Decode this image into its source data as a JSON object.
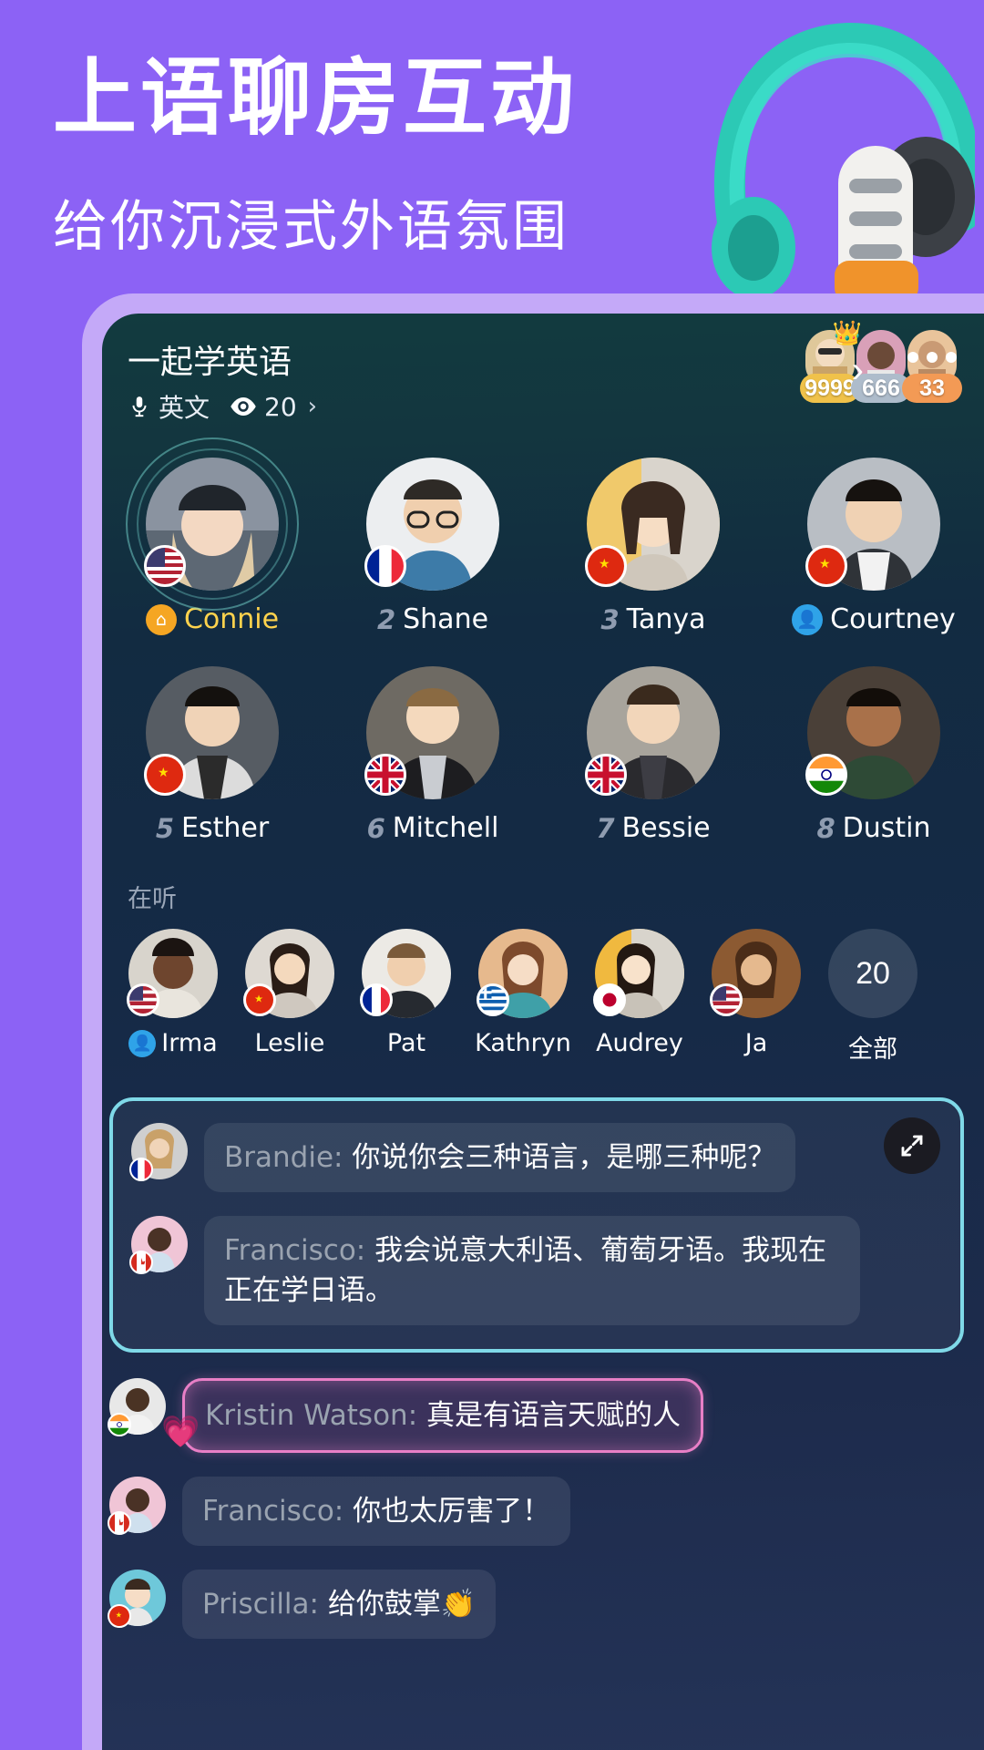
{
  "hero": {
    "title": "上语聊房互动",
    "subtitle": "给你沉浸式外语氛围",
    "illustration": "headphones-microphone-illustration"
  },
  "room": {
    "title": "一起学英语",
    "language_chip": {
      "icon": "microphone-icon",
      "label": "英文"
    },
    "viewers_chip": {
      "icon": "eye-icon",
      "label": "20",
      "chevron": "›"
    },
    "more_arrow": "›",
    "more_menu_icon": "ellipsis-icon",
    "rank_badges": [
      {
        "value": "9999",
        "color": "#f0c24a",
        "crown": "👑"
      },
      {
        "value": "666",
        "color": "#aebccb",
        "crown": ""
      },
      {
        "value": "33",
        "color": "#f39a55",
        "crown": ""
      }
    ]
  },
  "seats": {
    "row1": [
      {
        "index": "",
        "name": "Connie",
        "flag": "us",
        "badge": "home-icon",
        "badge_color": "#f5a623",
        "host": true
      },
      {
        "index": "2",
        "name": "Shane",
        "flag": "fr",
        "badge": "",
        "badge_color": "",
        "host": false
      },
      {
        "index": "3",
        "name": "Tanya",
        "flag": "cn",
        "badge": "",
        "badge_color": "",
        "host": false
      },
      {
        "index": "",
        "name": "Courtney",
        "flag": "cn",
        "badge": "person-icon",
        "badge_color": "#2fa3e8",
        "host": false
      }
    ],
    "row2": [
      {
        "index": "5",
        "name": "Esther",
        "flag": "cn",
        "badge": "",
        "badge_color": "",
        "host": false
      },
      {
        "index": "6",
        "name": "Mitchell",
        "flag": "gb",
        "badge": "",
        "badge_color": "",
        "host": false
      },
      {
        "index": "7",
        "name": "Bessie",
        "flag": "gb",
        "badge": "",
        "badge_color": "",
        "host": false
      },
      {
        "index": "8",
        "name": "Dustin",
        "flag": "in",
        "badge": "",
        "badge_color": "",
        "host": false
      }
    ]
  },
  "listeners": {
    "section_label": "在听",
    "items": [
      {
        "name": "Irma",
        "flag": "us",
        "badge": "person-icon",
        "badge_color": "#2fa3e8"
      },
      {
        "name": "Leslie",
        "flag": "cn",
        "badge": "",
        "badge_color": ""
      },
      {
        "name": "Pat",
        "flag": "fr",
        "badge": "",
        "badge_color": ""
      },
      {
        "name": "Kathryn",
        "flag": "gr",
        "badge": "",
        "badge_color": ""
      },
      {
        "name": "Audrey",
        "flag": "jp",
        "badge": "",
        "badge_color": ""
      },
      {
        "name": "Ja",
        "flag": "us",
        "badge": "",
        "badge_color": ""
      }
    ],
    "all_count": "20",
    "all_label": "全部"
  },
  "chat": {
    "expand_icon": "expand-icon",
    "highlighted": [
      {
        "who": "Brandie:",
        "text": "你说你会三种语言，是哪三种呢？",
        "flag": "fr",
        "style": "plain"
      },
      {
        "who": "Francisco:",
        "text": "我会说意大利语、葡萄牙语。我现在正在学日语。",
        "flag": "ca",
        "style": "plain"
      }
    ],
    "messages": [
      {
        "who": "Kristin Watson:",
        "text": "真是有语言天赋的人",
        "flag": "in",
        "style": "pink",
        "deco": "💗"
      },
      {
        "who": "Francisco:",
        "text": "你也太厉害了！",
        "flag": "ca",
        "style": "plain",
        "deco": ""
      },
      {
        "who": "Priscilla:",
        "text": "给你鼓掌👏",
        "flag": "cn",
        "style": "plain",
        "deco": ""
      }
    ]
  },
  "colors": {
    "page_background": "#8c62f5",
    "phone_border": "#c4a9f8",
    "screen_top": "#123b3f",
    "screen_bottom": "#243357",
    "highlight_border": "#7fd9e8",
    "host_name": "#ffd34d",
    "pink_border": "#e87fc6"
  }
}
